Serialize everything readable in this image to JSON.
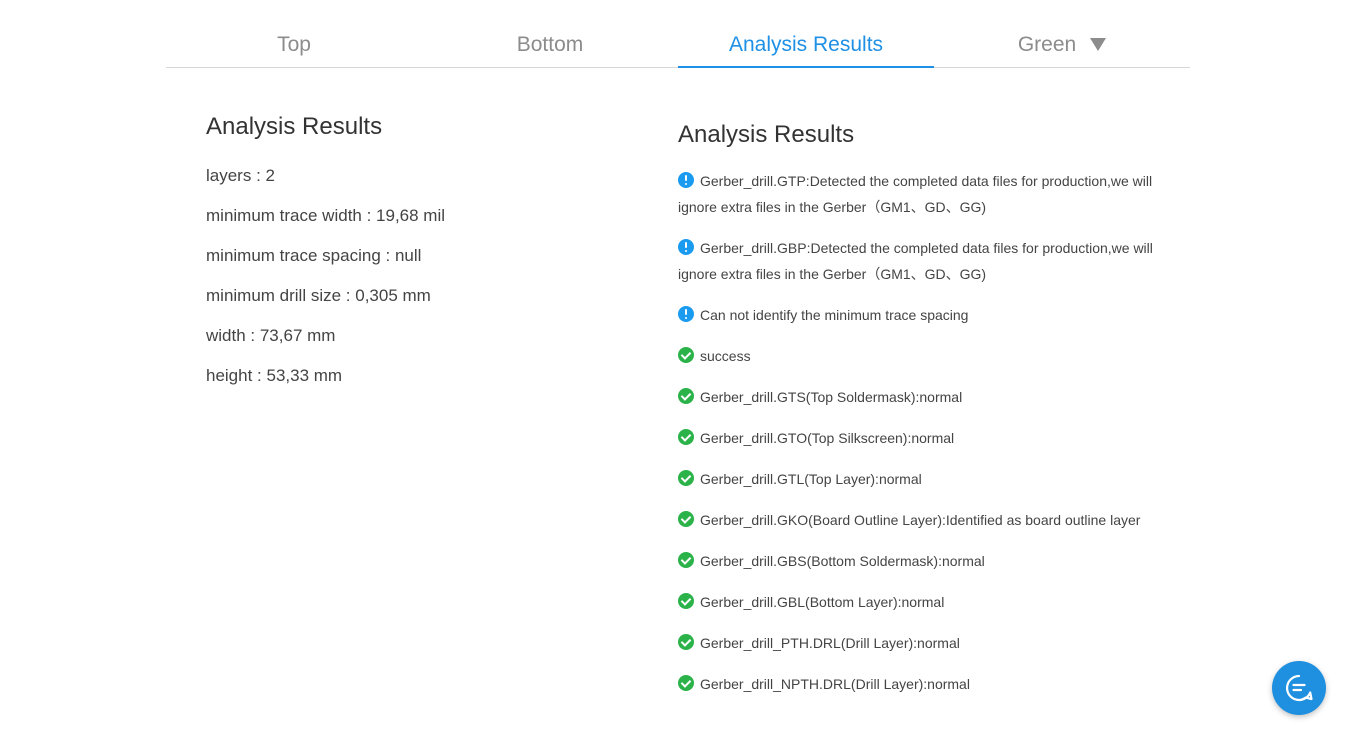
{
  "tabs": [
    {
      "label": "Top",
      "active": false
    },
    {
      "label": "Bottom",
      "active": false
    },
    {
      "label": "Analysis Results",
      "active": true
    },
    {
      "label": "Green",
      "active": false,
      "dropdown": true
    }
  ],
  "left": {
    "title": "Analysis Results",
    "stats": [
      "layers : 2",
      "minimum trace width : 19,68 mil",
      "minimum trace spacing : null",
      "minimum drill size : 0,305 mm",
      "width : 73,67 mm",
      "height : 53,33 mm"
    ]
  },
  "right": {
    "title": "Analysis Results",
    "results": [
      {
        "type": "info",
        "text": "Gerber_drill.GTP:Detected the completed data files for production,we will ignore extra files in the Gerber（GM1、GD、GG)"
      },
      {
        "type": "info",
        "text": "Gerber_drill.GBP:Detected the completed data files for production,we will ignore extra files in the Gerber（GM1、GD、GG)"
      },
      {
        "type": "info",
        "text": "Can not identify the minimum trace spacing"
      },
      {
        "type": "ok",
        "text": "success"
      },
      {
        "type": "ok",
        "text": "Gerber_drill.GTS(Top Soldermask):normal"
      },
      {
        "type": "ok",
        "text": "Gerber_drill.GTO(Top Silkscreen):normal"
      },
      {
        "type": "ok",
        "text": "Gerber_drill.GTL(Top Layer):normal"
      },
      {
        "type": "ok",
        "text": "Gerber_drill.GKO(Board Outline Layer):Identified as board outline layer"
      },
      {
        "type": "ok",
        "text": "Gerber_drill.GBS(Bottom Soldermask):normal"
      },
      {
        "type": "ok",
        "text": "Gerber_drill.GBL(Bottom Layer):normal"
      },
      {
        "type": "ok",
        "text": "Gerber_drill_PTH.DRL(Drill Layer):normal"
      },
      {
        "type": "ok",
        "text": "Gerber_drill_NPTH.DRL(Drill Layer):normal"
      }
    ]
  },
  "colors": {
    "accent": "#1e90e6",
    "info": "#1a9bf0",
    "success": "#2bb34a",
    "tab_inactive": "#8c8c8c"
  },
  "icons": {
    "info": "info-circle-icon",
    "ok": "check-circle-icon",
    "dropdown": "caret-down-icon",
    "chat": "chat-bubble-icon"
  }
}
